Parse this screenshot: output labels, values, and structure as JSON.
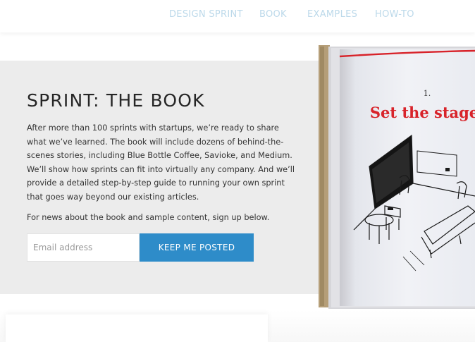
{
  "nav": {
    "items": [
      {
        "label": "DESIGN SPRINT"
      },
      {
        "label": "BOOK"
      },
      {
        "label": "EXAMPLES"
      },
      {
        "label": "HOW-TO"
      }
    ],
    "link_color": "#bcd9ea"
  },
  "hero": {
    "title": "SPRINT: THE BOOK",
    "description": "After more than 100 sprints with startups, we’re ready to share what we’ve learned. The book will include dozens of behind-the-scenes stories, including Blue Bottle Coffee, Savioke, and Medium. We’ll show how sprints can fit into virtually any company. And we’ll provide a detailed step-by-step guide to running your own sprint that goes way beyond our existing articles.",
    "note": "For news about the book and sample content, sign up below.",
    "background": "#ececec"
  },
  "signup": {
    "email_placeholder": "Email address",
    "email_value": "",
    "button_label": "KEEP ME POSTED",
    "button_color": "#2e8cc9"
  },
  "book": {
    "chapter_number": "1.",
    "chapter_title": "Set the stage",
    "title_color": "#d8232a"
  }
}
